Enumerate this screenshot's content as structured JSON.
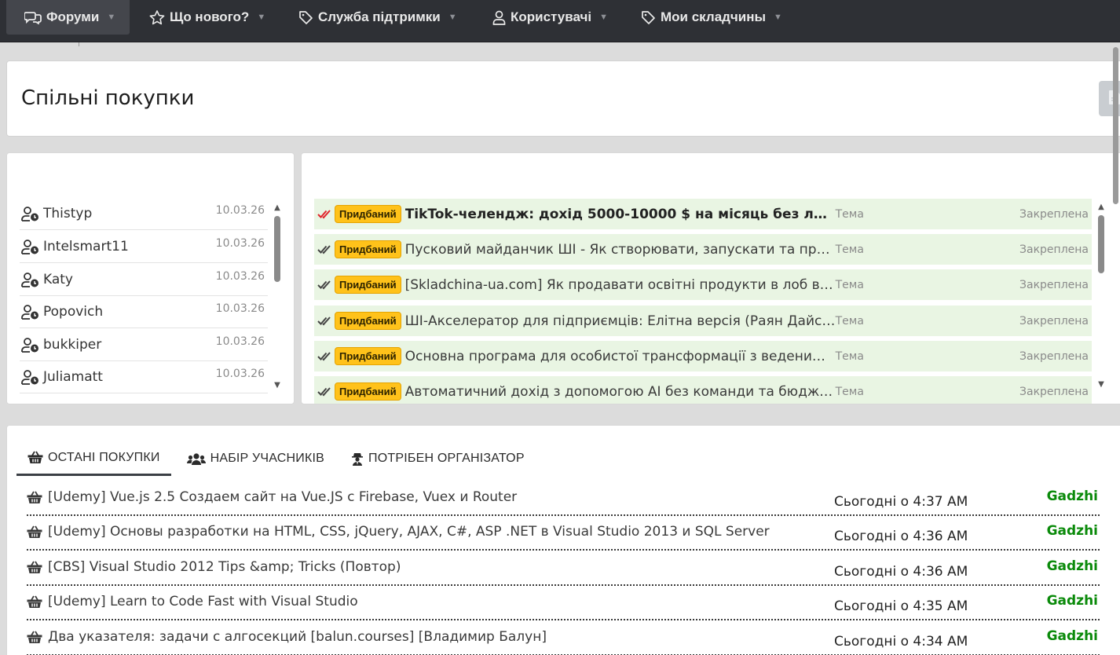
{
  "nav": {
    "items": [
      {
        "label": "Форуми",
        "icon": "chat-icon"
      },
      {
        "label": "Що нового?",
        "icon": "star-icon"
      },
      {
        "label": "Служба підтримки",
        "icon": "tag-icon"
      },
      {
        "label": "Користувачі",
        "icon": "user-icon"
      },
      {
        "label": "Мои складчины",
        "icon": "tag-icon"
      }
    ]
  },
  "page": {
    "title": "Спільні покупки"
  },
  "users": {
    "items": [
      {
        "name": "Thistyp",
        "date": "10.03.26"
      },
      {
        "name": "Intelsmart11",
        "date": "10.03.26"
      },
      {
        "name": "Katy",
        "date": "10.03.26"
      },
      {
        "name": "Popovich",
        "date": "10.03.26"
      },
      {
        "name": "bukkiper",
        "date": "10.03.26"
      },
      {
        "name": "Juliamatt",
        "date": "10.03.26"
      }
    ]
  },
  "threads": {
    "items": [
      {
        "badge": "Придбаний",
        "title": "TikTok-челендж: дохід 5000-10000 $ на місяць без лиця та голос...",
        "type": "Тема",
        "status": "Закреплена"
      },
      {
        "badge": "Придбаний",
        "title": "Пусковий майданчик ШІ - Як створювати, запускати та продавати...",
        "type": "Тема",
        "status": "Закреплена"
      },
      {
        "badge": "Придбаний",
        "title": "[Skladchina-ua.com] Як продавати освітні продукти в лоб в Україні...",
        "type": "Тема",
        "status": "Закреплена"
      },
      {
        "badge": "Придбаний",
        "title": "ШІ-Акселератор для підприємців: Елітна версія (Раян Дайс) україн...",
        "type": "Тема",
        "status": "Закреплена"
      },
      {
        "badge": "Придбаний",
        "title": "Основна програма для особистої трансформації з веденими меди...",
        "type": "Тема",
        "status": "Закреплена"
      },
      {
        "badge": "Придбаний",
        "title": "Автоматичний дохід з допомогою AI без команди та бюджету (Ел...",
        "type": "Тема",
        "status": "Закреплена"
      }
    ]
  },
  "recent": {
    "tabs": [
      {
        "label": "ОСТАНІ ПОКУПКИ",
        "icon": "basket-icon"
      },
      {
        "label": "НАБІР УЧАСНИКІВ",
        "icon": "users-icon"
      },
      {
        "label": "ПОТРІБЕН ОРГАНІЗАТОР",
        "icon": "organizer-icon"
      }
    ],
    "items": [
      {
        "title": "[Udemy] Vue.js 2.5 Создаем сайт на Vue.JS с Firebase, Vuex и Router",
        "time": "Сьогодні о 4:37 AM",
        "user": "Gadzhi"
      },
      {
        "title": "[Udemy] Основы разработки на HTML, CSS, jQuery, AJAX, C#, ASP .NET в Visual Studio 2013 и SQL Server",
        "time": "Сьогодні о 4:36 AM",
        "user": "Gadzhi"
      },
      {
        "title": "[CBS] Visual Studio 2012 Tips &amp; Tricks (Повтор)",
        "time": "Сьогодні о 4:36 AM",
        "user": "Gadzhi"
      },
      {
        "title": "[Udemy] Learn to Code Fast with Visual Studio",
        "time": "Сьогодні о 4:35 AM",
        "user": "Gadzhi"
      },
      {
        "title": "Два указателя: задачи с алгосекций [balun.courses] [Владимир Балун]",
        "time": "Сьогодні о 4:34 AM",
        "user": "Gadzhi"
      }
    ]
  },
  "colors": {
    "nav_bg": "#2e3035",
    "badge_bg": "#ffc21a",
    "thread_bg": "#e9f5e3",
    "user_link": "#0a8a0a",
    "check_red": "#e0242b"
  }
}
